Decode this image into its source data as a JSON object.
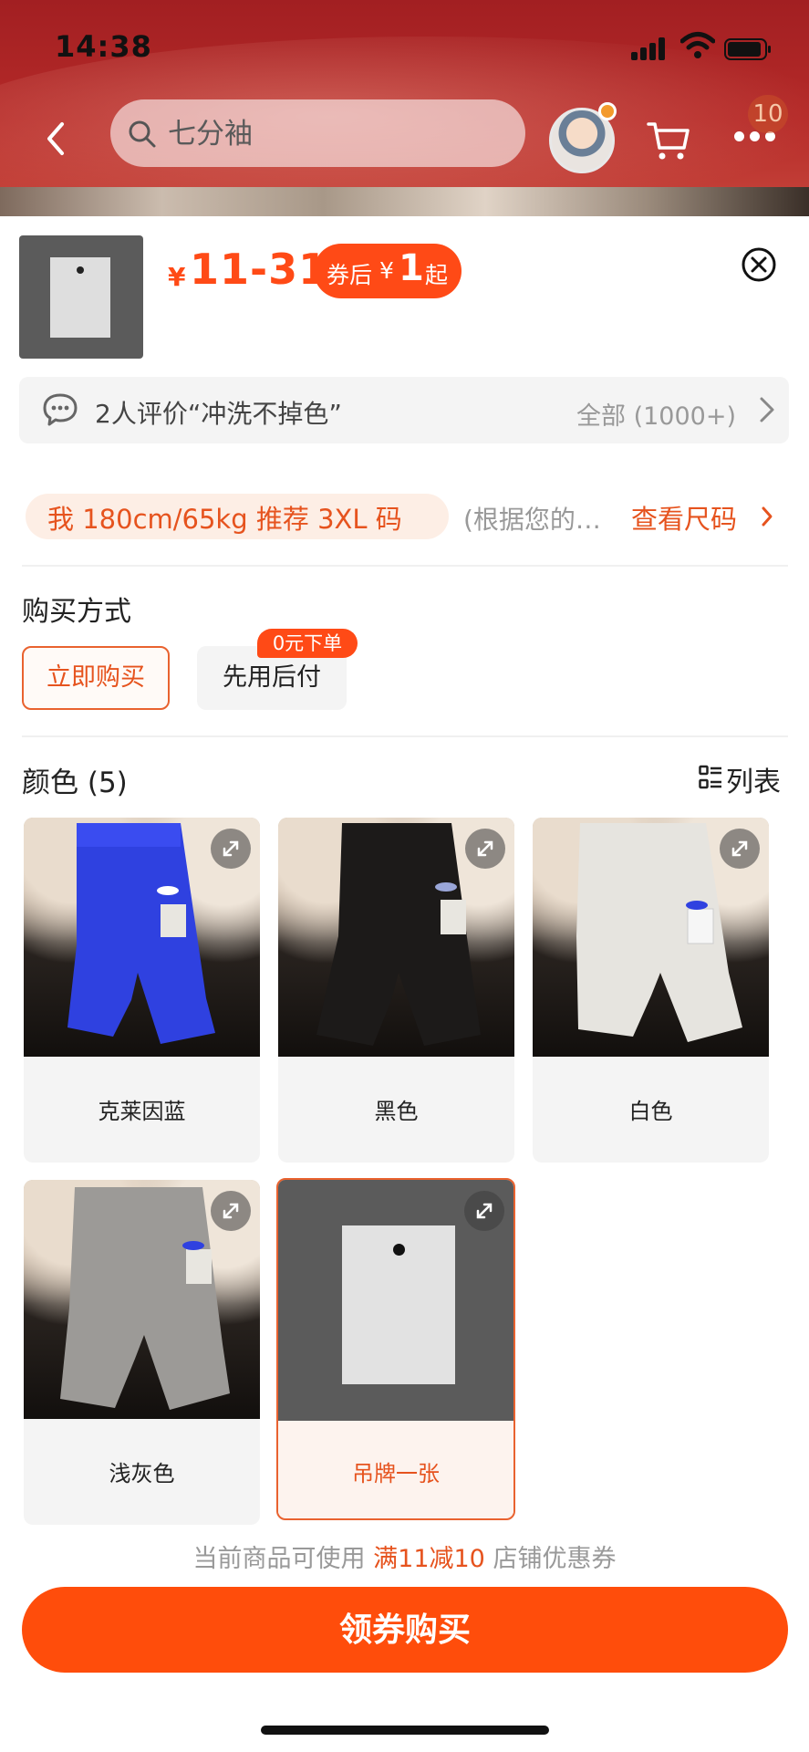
{
  "status_bar": {
    "time": "14:38"
  },
  "search": {
    "placeholder": "七分袖"
  },
  "header": {
    "notification_count": "10"
  },
  "product": {
    "price_symbol": "¥",
    "price_range": "11-31",
    "coupon": {
      "prefix": "券后",
      "symbol": "¥",
      "amount": "1",
      "suffix": "起"
    }
  },
  "reviews": {
    "summary": "2人评价“冲洗不掉色”",
    "all_label": "全部 (1000+)"
  },
  "size": {
    "recommendation": "我 180cm/65kg 推荐 3XL 码",
    "note": "(根据您的…",
    "chart_link": "查看尺码"
  },
  "purchase_method": {
    "title": "购买方式",
    "options": [
      {
        "label": "立即购买",
        "selected": true
      },
      {
        "label": "先用后付",
        "badge": "0元下单",
        "selected": false
      }
    ]
  },
  "colors": {
    "title": "颜色 (5)",
    "list_label": "列表",
    "items": [
      {
        "label": "克莱因蓝",
        "swatch_color": "#2f41e0",
        "selected": false
      },
      {
        "label": "黑色",
        "swatch_color": "#1c1a19",
        "selected": false
      },
      {
        "label": "白色",
        "swatch_color": "#e6e4df",
        "selected": false
      },
      {
        "label": "浅灰色",
        "swatch_color": "#9c9a97",
        "selected": false
      },
      {
        "label": "吊牌一张",
        "swatch_color": "#5b5b5b",
        "selected": true
      }
    ]
  },
  "footer": {
    "notice_before": "当前商品可使用",
    "notice_highlight": "满11减10",
    "notice_after": "店铺优惠券",
    "button_label": "领券购买"
  },
  "theme": {
    "accent": "#ff4a16",
    "header_red": "#a21f22"
  }
}
